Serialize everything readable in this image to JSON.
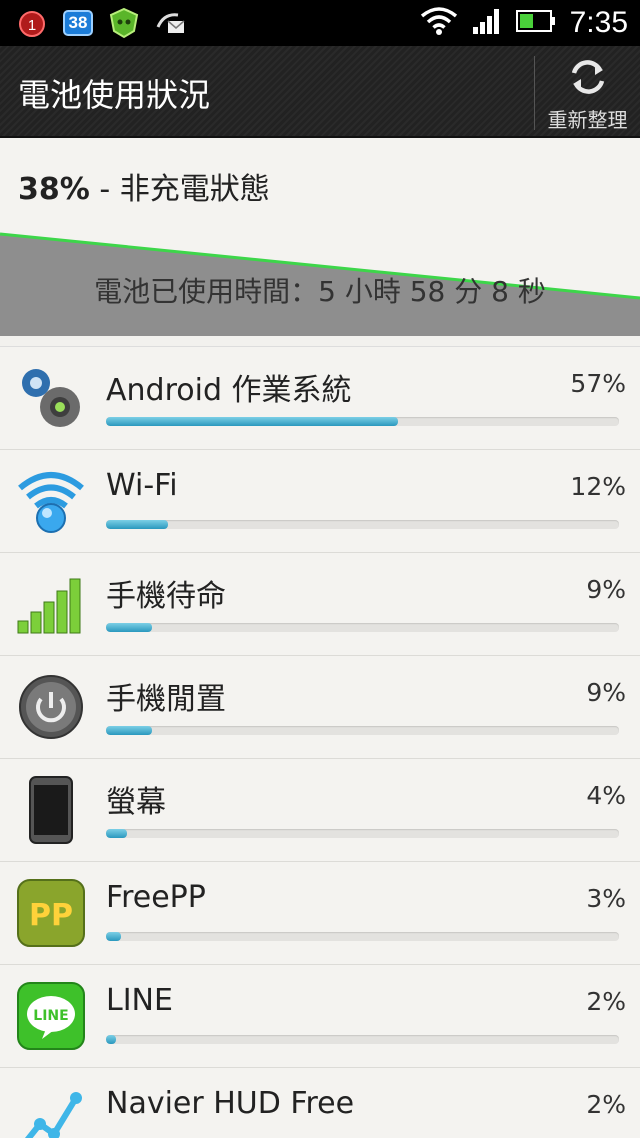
{
  "status_bar": {
    "notification_badge": "38",
    "alarm_badge": "1",
    "time": "7:35"
  },
  "header": {
    "title": "電池使用狀況",
    "refresh_label": "重新整理"
  },
  "summary": {
    "percent": "38%",
    "state": " - 非充電狀態"
  },
  "graph": {
    "used_time": "電池已使用時間：5 小時 58 分 8 秒"
  },
  "items": [
    {
      "name": "Android 作業系統",
      "percent": "57%",
      "value": 57,
      "icon": "android-os-gears-icon"
    },
    {
      "name": "Wi-Fi",
      "percent": "12%",
      "value": 12,
      "icon": "wifi-icon"
    },
    {
      "name": "手機待命",
      "percent": "9%",
      "value": 9,
      "icon": "signal-bars-icon"
    },
    {
      "name": "手機閒置",
      "percent": "9%",
      "value": 9,
      "icon": "power-icon"
    },
    {
      "name": "螢幕",
      "percent": "4%",
      "value": 4,
      "icon": "screen-phone-icon"
    },
    {
      "name": " FreePP",
      "percent": "3%",
      "value": 3,
      "icon": "freepp-app-icon"
    },
    {
      "name": "LINE",
      "percent": "2%",
      "value": 2,
      "icon": "line-app-icon"
    },
    {
      "name": "Navier HUD Free",
      "percent": "2%",
      "value": 2,
      "icon": "navier-hud-app-icon"
    }
  ],
  "colors": {
    "bar_fill": "#2a98be",
    "graph_line": "#3dd64a",
    "graph_fill": "#8c8c8c"
  }
}
